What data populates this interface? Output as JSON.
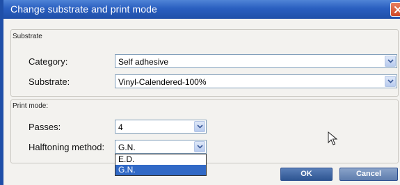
{
  "dialog": {
    "title": "Change substrate and print mode"
  },
  "substrate": {
    "group_label": "Substrate",
    "category_label": "Category:",
    "category_value": "Self adhesive",
    "substrate_label": "Substrate:",
    "substrate_value": "Vinyl-Calendered-100%"
  },
  "print_mode": {
    "group_label": "Print mode:",
    "passes_label": "Passes:",
    "passes_value": "4",
    "halftoning_label": "Halftoning method:",
    "halftoning_value": "G.N.",
    "halftoning_options": [
      "E.D.",
      "G.N."
    ],
    "halftoning_selected": "G.N."
  },
  "buttons": {
    "ok": "OK",
    "cancel": "Cancel"
  },
  "colors": {
    "titlebar": "#2a5fc0",
    "selection": "#3169c6",
    "close": "#cf4a28"
  }
}
